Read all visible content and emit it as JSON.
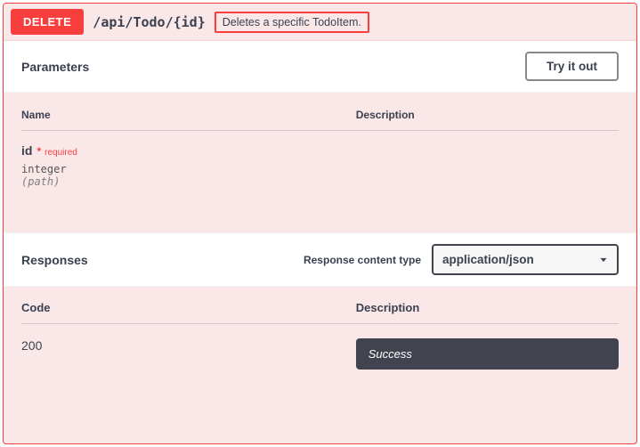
{
  "summary": {
    "method": "DELETE",
    "path": "/api/Todo/{id}",
    "description": "Deletes a specific TodoItem."
  },
  "parameters": {
    "title": "Parameters",
    "try_label": "Try it out",
    "columns": {
      "name": "Name",
      "description": "Description"
    },
    "items": [
      {
        "name": "id",
        "required_text": "required",
        "type": "integer",
        "in": "(path)"
      }
    ]
  },
  "responses": {
    "title": "Responses",
    "content_type_label": "Response content type",
    "content_type_value": "application/json",
    "columns": {
      "code": "Code",
      "description": "Description"
    },
    "items": [
      {
        "code": "200",
        "description": "Success"
      }
    ]
  }
}
